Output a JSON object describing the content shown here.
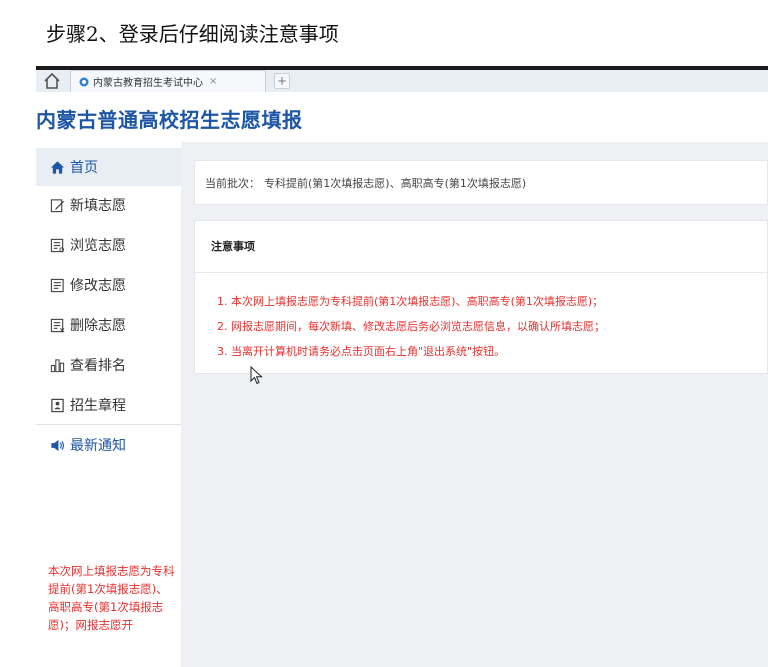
{
  "caption": "步骤2、登录后仔细阅读注意事项",
  "browser": {
    "tab_title": "内蒙古教育招生考试中心",
    "tab_close": "×",
    "new_tab": "+"
  },
  "app": {
    "title": "内蒙古普通高校招生志愿填报",
    "accent_color": "#1d56a5",
    "alert_color": "#e5312e"
  },
  "sidebar": {
    "items": [
      {
        "label": "首页",
        "icon": "home-icon"
      },
      {
        "label": "新填志愿",
        "icon": "edit-icon"
      },
      {
        "label": "浏览志愿",
        "icon": "list-icon"
      },
      {
        "label": "修改志愿",
        "icon": "document-icon"
      },
      {
        "label": "删除志愿",
        "icon": "delete-list-icon"
      },
      {
        "label": "查看排名",
        "icon": "bar-chart-icon"
      },
      {
        "label": "招生章程",
        "icon": "id-card-icon"
      }
    ],
    "notice": {
      "label": "最新通知",
      "icon": "speaker-icon"
    },
    "notice_text": "本次网上填报志愿为专科提前(第1次填报志愿)、高职高专(第1次填报志愿)；网报志愿开"
  },
  "batch": {
    "label": "当前批次：",
    "value": "专科提前(第1次填报志愿)、高职高专(第1次填报志愿)"
  },
  "notice_panel": {
    "title": "注意事项",
    "lines": [
      "1. 本次网上填报志愿为专科提前(第1次填报志愿)、高职高专(第1次填报志愿)；",
      "2. 网报志愿期间，每次新填、修改志愿后务必浏览志愿信息，以确认所填志愿；",
      "3. 当离开计算机时请务必点击页面右上角\"退出系统\"按钮。"
    ]
  }
}
